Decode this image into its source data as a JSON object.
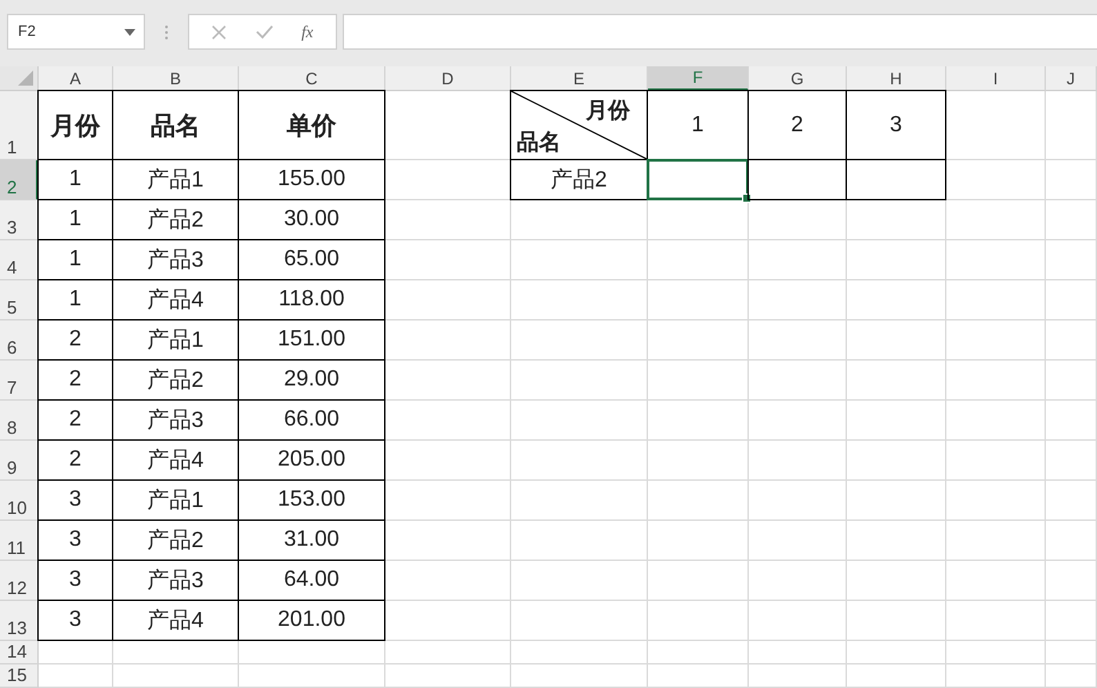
{
  "name_box": {
    "value": "F2"
  },
  "formula_bar": {
    "function_label": "fx"
  },
  "column_headers": [
    {
      "label": "A",
      "selected": false
    },
    {
      "label": "B",
      "selected": false
    },
    {
      "label": "C",
      "selected": false
    },
    {
      "label": "D",
      "selected": false
    },
    {
      "label": "E",
      "selected": false
    },
    {
      "label": "F",
      "selected": true
    },
    {
      "label": "G",
      "selected": false
    },
    {
      "label": "H",
      "selected": false
    },
    {
      "label": "I",
      "selected": false
    },
    {
      "label": "J",
      "selected": false
    }
  ],
  "row_headers": [
    {
      "label": "1",
      "selected": false
    },
    {
      "label": "2",
      "selected": true
    },
    {
      "label": "3",
      "selected": false
    },
    {
      "label": "4",
      "selected": false
    },
    {
      "label": "5",
      "selected": false
    },
    {
      "label": "6",
      "selected": false
    },
    {
      "label": "7",
      "selected": false
    },
    {
      "label": "8",
      "selected": false
    },
    {
      "label": "9",
      "selected": false
    },
    {
      "label": "10",
      "selected": false
    },
    {
      "label": "11",
      "selected": false
    },
    {
      "label": "12",
      "selected": false
    },
    {
      "label": "13",
      "selected": false
    },
    {
      "label": "14",
      "selected": false
    },
    {
      "label": "15",
      "selected": false
    }
  ],
  "price_table": {
    "headers": [
      "月份",
      "品名",
      "单价"
    ],
    "rows": [
      [
        "1",
        "产品1",
        "155.00"
      ],
      [
        "1",
        "产品2",
        "30.00"
      ],
      [
        "1",
        "产品3",
        "65.00"
      ],
      [
        "1",
        "产品4",
        "118.00"
      ],
      [
        "2",
        "产品1",
        "151.00"
      ],
      [
        "2",
        "产品2",
        "29.00"
      ],
      [
        "2",
        "产品3",
        "66.00"
      ],
      [
        "2",
        "产品4",
        "205.00"
      ],
      [
        "3",
        "产品1",
        "153.00"
      ],
      [
        "3",
        "产品2",
        "31.00"
      ],
      [
        "3",
        "产品3",
        "64.00"
      ],
      [
        "3",
        "产品4",
        "201.00"
      ]
    ]
  },
  "cross_table": {
    "corner_top": "月份",
    "corner_bottom": "品名",
    "months": [
      "1",
      "2",
      "3"
    ],
    "rows": [
      {
        "product": "产品2",
        "cells": [
          {
            "selected": true
          },
          {
            "selected": false
          },
          {
            "selected": false
          }
        ]
      }
    ]
  }
}
